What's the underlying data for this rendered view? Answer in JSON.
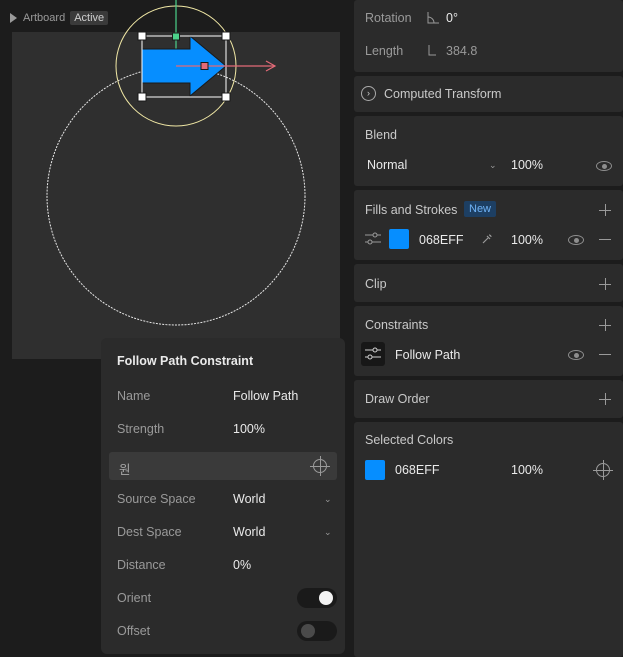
{
  "canvas": {
    "play_icon": "play-icon",
    "artboard_name": "Artboard",
    "state_badge": "Active",
    "shape_fill": "#068EFF"
  },
  "transform": {
    "rotation_label": "Rotation",
    "rotation_value": "0°",
    "length_label": "Length",
    "length_value": "384.8"
  },
  "computed_transform": {
    "label": "Computed Transform"
  },
  "blend": {
    "title": "Blend",
    "mode": "Normal",
    "opacity": "100%"
  },
  "fills": {
    "title": "Fills and Strokes",
    "badge": "New",
    "hex": "068EFF",
    "opacity": "100%",
    "color": "#068EFF"
  },
  "clip": {
    "title": "Clip"
  },
  "constraints": {
    "title": "Constraints",
    "item_label": "Follow Path"
  },
  "draw_order": {
    "title": "Draw Order"
  },
  "selected_colors": {
    "title": "Selected Colors",
    "hex": "068EFF",
    "opacity": "100%"
  },
  "popup": {
    "title": "Follow Path Constraint",
    "name_label": "Name",
    "name_value": "Follow Path",
    "strength_label": "Strength",
    "strength_value": "100%",
    "target_value": "원",
    "source_space_label": "Source Space",
    "source_space_value": "World",
    "dest_space_label": "Dest Space",
    "dest_space_value": "World",
    "distance_label": "Distance",
    "distance_value": "0%",
    "orient_label": "Orient",
    "orient_on": true,
    "offset_label": "Offset",
    "offset_on": false
  }
}
